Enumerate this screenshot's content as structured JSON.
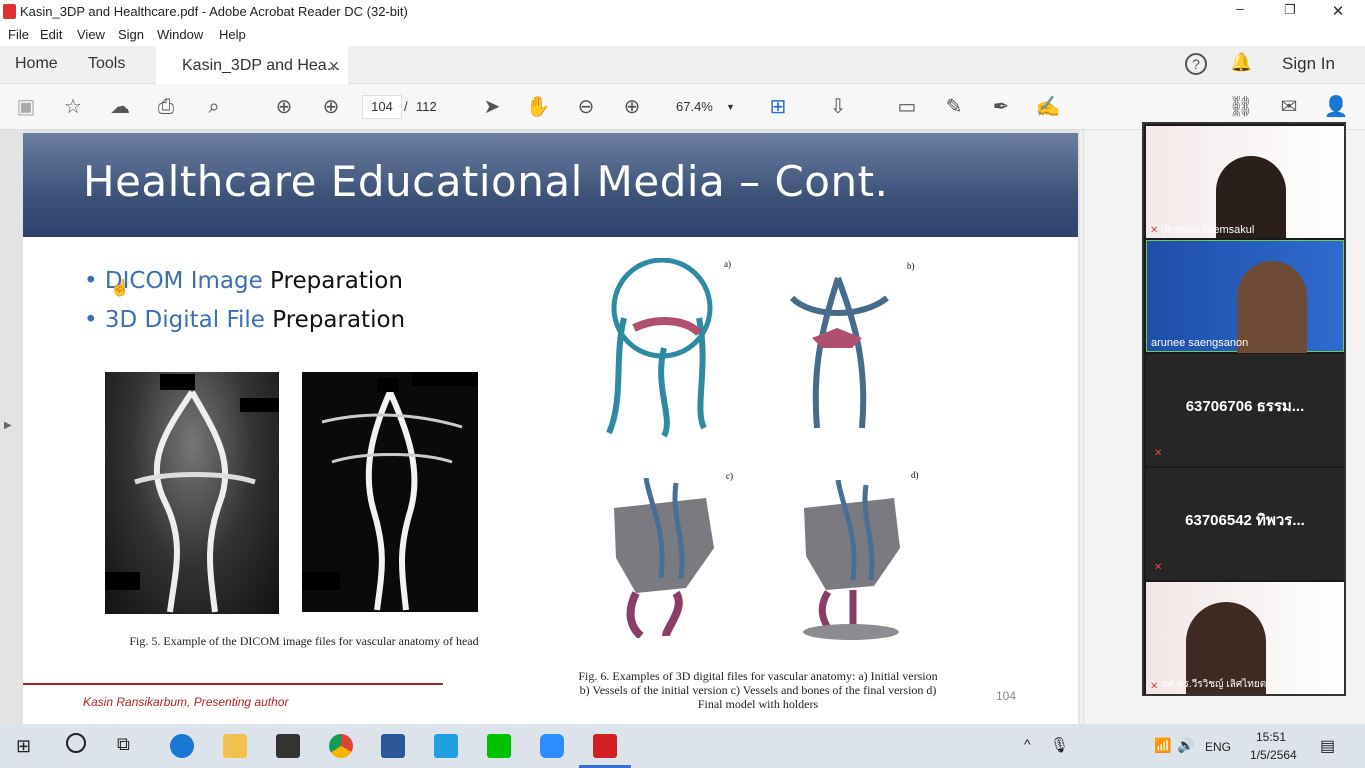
{
  "window": {
    "title": "Kasin_3DP and Healthcare.pdf - Adobe Acrobat Reader DC (32-bit)"
  },
  "menu": [
    "File",
    "Edit",
    "View",
    "Sign",
    "Window",
    "Help"
  ],
  "tabs": {
    "home": "Home",
    "tools": "Tools",
    "document": "Kasin_3DP and Hea...",
    "sign_in": "Sign In"
  },
  "toolbar": {
    "page_current": "104",
    "page_separator": "/",
    "page_total": "112",
    "zoom": "67.4%"
  },
  "slide": {
    "title": "Healthcare Educational Media – Cont.",
    "bullets": [
      {
        "highlight": "DICOM Image",
        "rest": " Preparation"
      },
      {
        "highlight": "3D Digital File",
        "rest": " Preparation"
      }
    ],
    "fig5_caption": "Fig. 5. Example of the DICOM image files for vascular anatomy of head",
    "fig6_caption_1": "Fig. 6. Examples of 3D digital files for vascular anatomy: a) Initial version",
    "fig6_caption_2": "b) Vessels of the initial version c) Vessels and bones of the final version d)",
    "fig6_caption_3": "Final model with holders",
    "labels": [
      "a)",
      "b)",
      "c)",
      "d)"
    ],
    "author": "Kasin Ransikarbum, Presenting author",
    "page_number": "104"
  },
  "participants": [
    {
      "name": "Jirawan Niemsakul"
    },
    {
      "name": "arunee saengsanon"
    },
    {
      "name": "63706706 ธรรม..."
    },
    {
      "name": "63706542 ทิพวร..."
    },
    {
      "name": "ผศ.ดร.วีรวิชญ์ เลิศไทยตระ..."
    }
  ],
  "taskbar": {
    "language": "ENG",
    "time": "15:51",
    "date": "1/5/2564"
  },
  "colors": {
    "accent": "#3c6fb0",
    "banner": "#3e5278",
    "author_line": "#b22222"
  }
}
